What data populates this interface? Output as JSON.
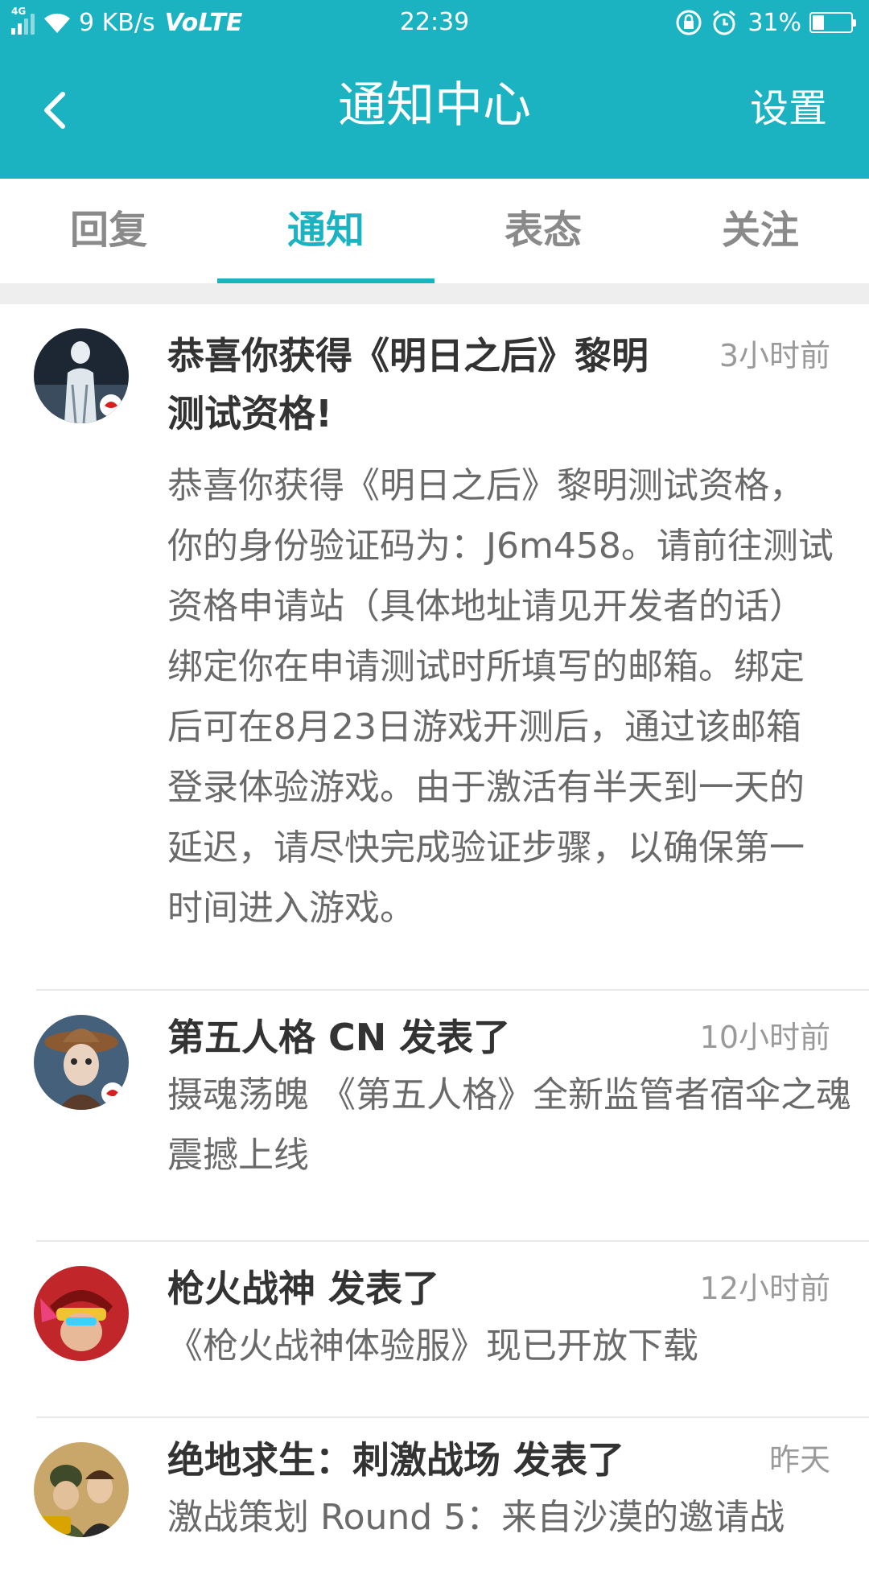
{
  "status_bar": {
    "network": "4G",
    "speed": "9 KB/s",
    "volte": "VoLTE",
    "time": "22:39",
    "battery": "31%",
    "battery_level": 0.31
  },
  "header": {
    "title": "通知中心",
    "settings_label": "设置"
  },
  "tabs": [
    {
      "label": "回复",
      "active": false
    },
    {
      "label": "通知",
      "active": true
    },
    {
      "label": "表态",
      "active": false
    },
    {
      "label": "关注",
      "active": false
    }
  ],
  "notifications": [
    {
      "title": "恭喜你获得《明日之后》黎明测试资格!",
      "time": "3小时前",
      "body": "恭喜你获得《明日之后》黎明测试资格，你的身份验证码为：J6m458。请前往测试资格申请站（具体地址请见开发者的话）绑定你在申请测试时所填写的邮箱。绑定后可在8月23日游戏开测后，通过该邮箱登录体验游戏。由于激活有半天到一天的延迟，请尽快完成验证步骤，以确保第一时间进入游戏。"
    },
    {
      "title": "第五人格 CN 发表了",
      "time": "10小时前",
      "body": "摄魂荡魄 《第五人格》全新监管者宿伞之魂震撼上线"
    },
    {
      "title": "枪火战神 发表了",
      "time": "12小时前",
      "body": "《枪火战神体验服》现已开放下载"
    },
    {
      "title": "绝地求生：刺激战场 发表了",
      "time": "昨天",
      "body": "激战策划 Round 5：来自沙漠的邀请战"
    }
  ]
}
